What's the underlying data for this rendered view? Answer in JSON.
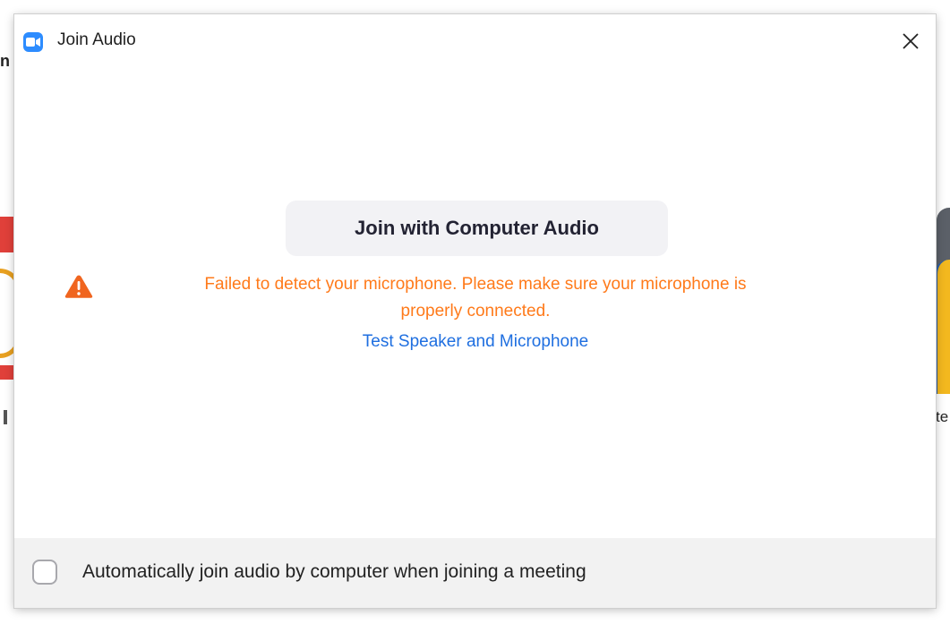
{
  "dialog": {
    "title": "Join Audio",
    "app_icon": "zoom-camera-icon",
    "close_icon": "close-icon"
  },
  "main": {
    "join_button_label": "Join with Computer Audio",
    "warning": {
      "icon": "warning-triangle-icon",
      "line1": "Failed to detect your microphone. Please make sure your microphone is",
      "line2": "properly connected.",
      "color": "#ff7a1a"
    },
    "test_link_label": "Test Speaker and Microphone",
    "link_color": "#1f6fe0"
  },
  "footer": {
    "auto_join_label": "Automatically join audio by computer when joining a meeting",
    "auto_join_checked": false
  },
  "colors": {
    "brand_blue": "#2d8cff",
    "button_bg": "#f2f2f5",
    "footer_bg": "#f2f2f2"
  }
}
